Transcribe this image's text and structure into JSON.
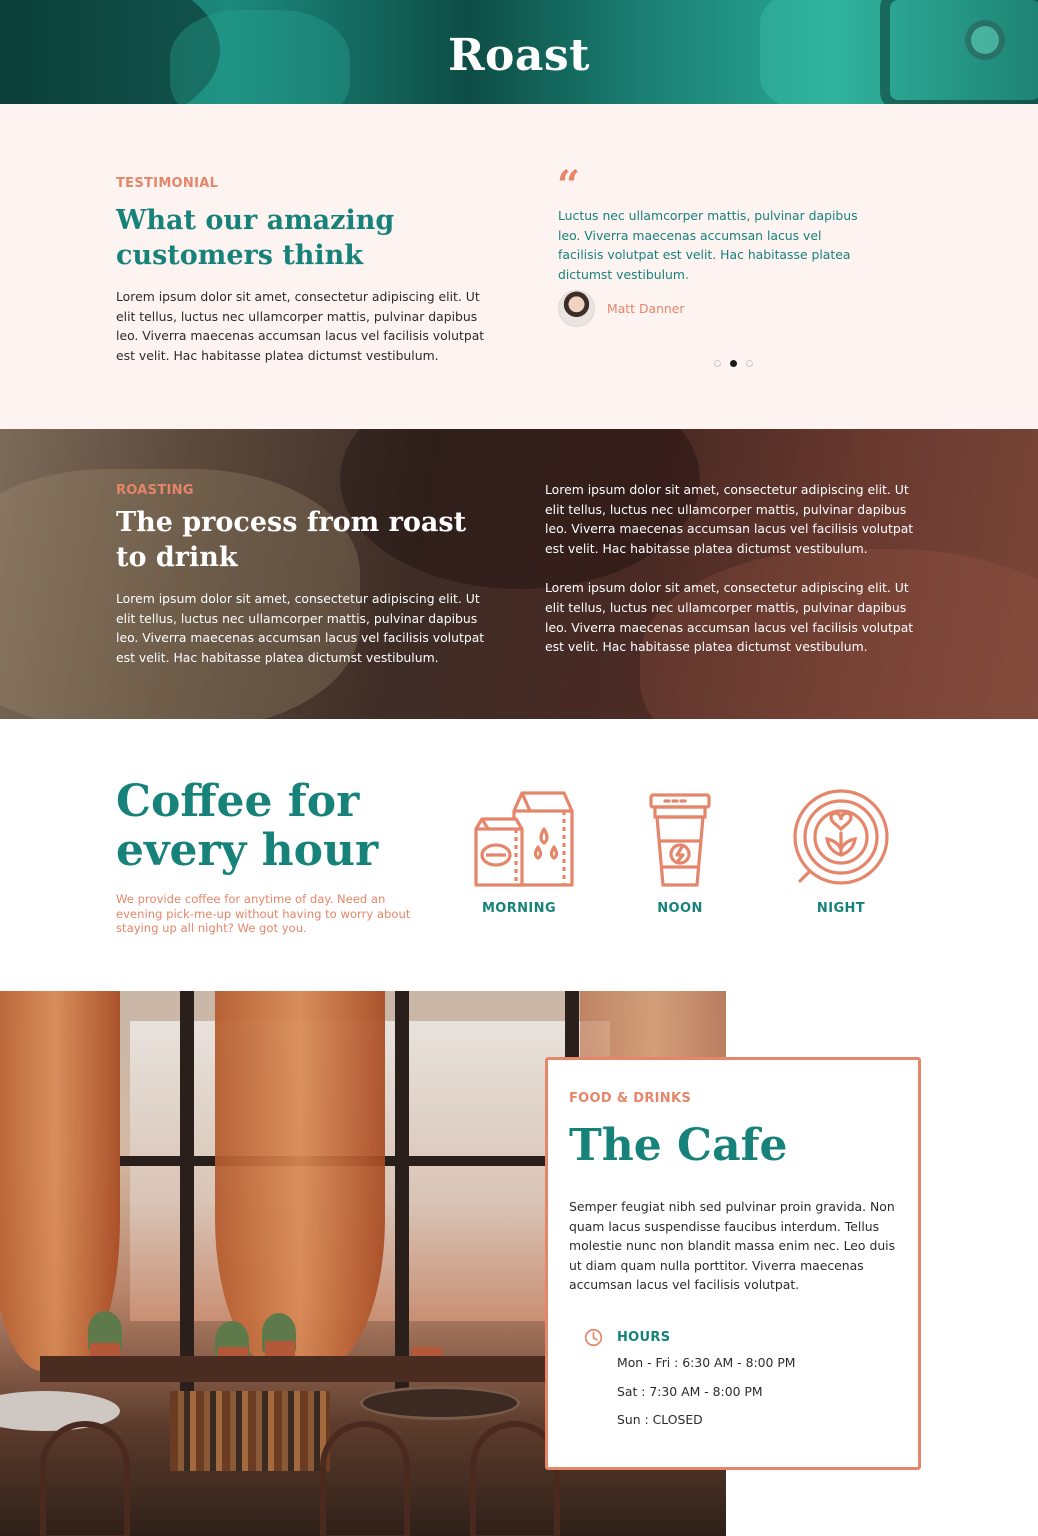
{
  "hero": {
    "title": "Roast"
  },
  "testimonial": {
    "eyebrow": "TESTIMONIAL",
    "heading_line1": "What our amazing",
    "heading_line2": "customers think",
    "body": "Lorem ipsum dolor sit amet, consectetur adipiscing elit. Ut elit tellus, luctus nec ullamcorper mattis, pulvinar dapibus leo. Viverra maecenas accumsan lacus vel facilisis volutpat est velit. Hac habitasse platea dictumst vestibulum.",
    "quote": "Luctus nec ullamcorper mattis, pulvinar dapibus leo. Viverra maecenas accumsan lacus vel facilisis volutpat est velit. Hac habitasse platea dictumst vestibulum.",
    "author": "Matt Danner",
    "slider": {
      "count": 3,
      "active_index": 1
    }
  },
  "roasting": {
    "eyebrow": "ROASTING",
    "heading_line1": "The process from roast",
    "heading_line2": "to drink",
    "body_left": "Lorem ipsum dolor sit amet, consectetur adipiscing elit. Ut elit tellus, luctus nec ullamcorper mattis, pulvinar dapibus leo. Viverra maecenas accumsan lacus vel facilisis volutpat est velit. Hac habitasse platea dictumst vestibulum.",
    "body_right_1": "Lorem ipsum dolor sit amet, consectetur adipiscing elit. Ut elit tellus, luctus nec ullamcorper mattis, pulvinar dapibus leo. Viverra maecenas accumsan lacus vel facilisis volutpat est velit. Hac habitasse platea dictumst vestibulum.",
    "body_right_2": "Lorem ipsum dolor sit amet, consectetur adipiscing elit. Ut elit tellus, luctus nec ullamcorper mattis, pulvinar dapibus leo. Viverra maecenas accumsan lacus vel facilisis volutpat est velit. Hac habitasse platea dictumst vestibulum."
  },
  "coffee_hours": {
    "title_line1": "Coffee for",
    "title_line2": "every hour",
    "subtitle": "We provide coffee for anytime of day. Need an evening pick-me-up without having to worry about staying up all night? We got you.",
    "items": [
      {
        "label": "MORNING",
        "icon": "milk-carton-icon"
      },
      {
        "label": "NOON",
        "icon": "coffee-cup-icon"
      },
      {
        "label": "NIGHT",
        "icon": "latte-art-icon"
      }
    ]
  },
  "cafe": {
    "eyebrow": "FOOD & DRINKS",
    "title": "The Cafe",
    "description": "Semper feugiat nibh sed pulvinar proin gravida. Non quam lacus suspendisse faucibus interdum. Tellus molestie nunc non blandit massa enim nec. Leo duis ut diam quam nulla porttitor. Viverra maecenas accumsan lacus vel facilisis volutpat.",
    "hours_title": "HOURS",
    "hours": [
      "Mon - Fri : 6:30 AM - 8:00 PM",
      "Sat : 7:30 AM - 8:00 PM",
      "Sun : CLOSED"
    ]
  },
  "colors": {
    "teal": "#17827a",
    "coral": "#e5866a",
    "blush_bg": "#fdf3f1",
    "text": "#2b2b2b"
  }
}
